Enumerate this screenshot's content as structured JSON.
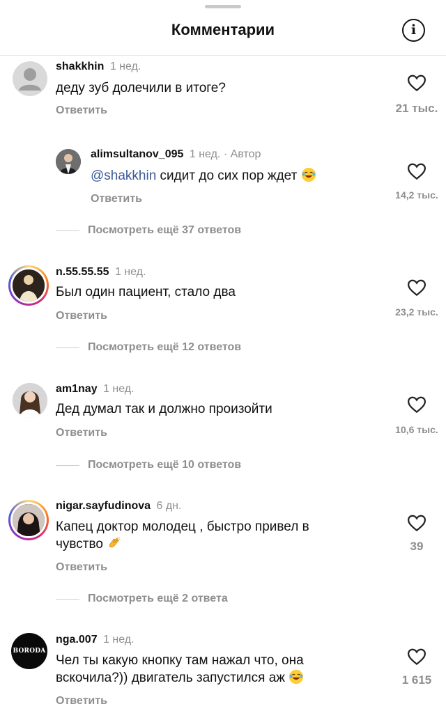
{
  "header": {
    "title": "Комментарии"
  },
  "comments": [
    {
      "user": "shakkhin",
      "time": "1 нед.",
      "text": "деду зуб долечили в итоге?",
      "reply_label": "Ответить",
      "likes": "21 тыс."
    },
    {
      "user": "alimsultanov_095",
      "time": "1 нед.",
      "author_badge": "· Автор",
      "mention": "@shakkhin",
      "text": " сидит до сих пор ждет",
      "reply_label": "Ответить",
      "likes": "14,2 тыс.",
      "more_replies": "Посмотреть ещё 37 ответов"
    },
    {
      "user": "n.55.55.55",
      "time": "1 нед.",
      "text": "Был один пациент, стало два",
      "reply_label": "Ответить",
      "likes": "23,2 тыс.",
      "more_replies": "Посмотреть ещё 12 ответов"
    },
    {
      "user": "am1nay",
      "time": "1 нед.",
      "text": "Дед думал так и должно произойти",
      "reply_label": "Ответить",
      "likes": "10,6 тыс.",
      "more_replies": "Посмотреть ещё 10 ответов"
    },
    {
      "user": "nigar.sayfudinova",
      "time": "6 дн.",
      "text_line1": "Капец доктор молодец , быстро привел в",
      "text_line2": "чувство",
      "reply_label": "Ответить",
      "likes": "39",
      "more_replies": "Посмотреть ещё 2 ответа"
    },
    {
      "user": "nga.007",
      "time": "1 нед.",
      "text_line1": "Чел ты какую кнопку там нажал что, она",
      "text_line2": "вскочила?)) двигатель запустился аж",
      "reply_label": "Ответить",
      "likes": "1 615",
      "avatar_text": "BORODA"
    }
  ],
  "colors": {
    "muted": "#8e8e8e",
    "mention": "#3b5998",
    "divider": "#e7e7e7"
  },
  "icons": [
    "info-icon",
    "heart-icon",
    "laughing-emoji",
    "clapping-hands-emoji",
    "default-avatar-icon"
  ]
}
